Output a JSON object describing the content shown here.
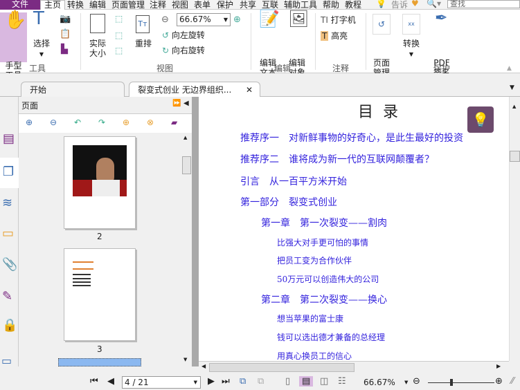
{
  "menu": {
    "file": "文件",
    "home": "主页",
    "items": [
      "转换",
      "编辑",
      "页面管理",
      "注释",
      "视图",
      "表单",
      "保护",
      "共享",
      "互联",
      "辅助工具",
      "帮助",
      "教程"
    ],
    "tell": "告诉",
    "search_placeholder": "查找"
  },
  "ribbon": {
    "hand_tool": "手型\n工具",
    "select": "选择",
    "tools_group": "工具",
    "actual_size": "实际\n大小",
    "reflow": "重排",
    "zoom_value": "66.67%",
    "rotate_left": "向左旋转",
    "rotate_right": "向右旋转",
    "view_group": "视图",
    "edit_text": "编辑\n文本",
    "edit_object": "编辑\n对象",
    "edit_group": "编辑",
    "typewriter": "打字机",
    "highlight": "高亮",
    "comment_group": "注释",
    "page_manage": "页面\n管理",
    "convert": "转换",
    "pdf_sign": "PDF\n签名",
    "protect_group": "保护"
  },
  "tabs": [
    {
      "label": "开始"
    },
    {
      "label": "裂变式创业 无边界组织..."
    }
  ],
  "panel": {
    "title": "页面",
    "thumbnails": [
      {
        "page": "2"
      },
      {
        "page": "3"
      }
    ]
  },
  "document": {
    "title": "目  录",
    "toc": [
      {
        "text": "推荐序一　对新鲜事物的好奇心，是此生最好的投资",
        "level": 0
      },
      {
        "text": "推荐序二　谁将成为新一代的互联网颠覆者？",
        "level": 0
      },
      {
        "text": "引言　从一百平方米开始",
        "level": 0
      },
      {
        "text": "第一部分　裂变式创业",
        "level": 0
      },
      {
        "text": "第一章　第一次裂变——割肉",
        "level": 1
      },
      {
        "text": "比强大对手更可怕的事情",
        "level": 2
      },
      {
        "text": "把员工变为合作伙伴",
        "level": 2
      },
      {
        "text": "50万元可以创造伟大的公司",
        "level": 2
      },
      {
        "text": "第二章　第二次裂变——换心",
        "level": 1
      },
      {
        "text": "想当苹果的富士康",
        "level": 2
      },
      {
        "text": "钱可以选出德才兼备的总经理",
        "level": 2
      },
      {
        "text": "用真心换员工的信心",
        "level": 2
      }
    ]
  },
  "status": {
    "page_input": "4 / 21",
    "zoom": "66.67%",
    "zoom_slider_fraction": 0.33
  },
  "colors": {
    "accent": "#7b2b83",
    "link": "#3322dd",
    "hand_bg": "#d9b8e0"
  }
}
